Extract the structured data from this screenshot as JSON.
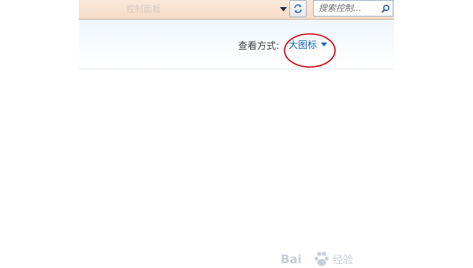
{
  "toolbar": {
    "address_text_faded": "控制面板",
    "search_placeholder": "搜索控制...",
    "icons": {
      "dropdown": "chevron-down-icon",
      "refresh": "refresh-icon",
      "search": "search-icon"
    }
  },
  "header": {
    "view_by_label": "查看方式:",
    "view_mode_value": "大图标"
  },
  "annotation": {
    "color": "#d8000c"
  },
  "watermark": {
    "text": "Bai 经验"
  },
  "colors": {
    "link_blue": "#1a66b8",
    "strip_bg": "#f6dcc7",
    "band_bg": "#f0f6fc"
  }
}
